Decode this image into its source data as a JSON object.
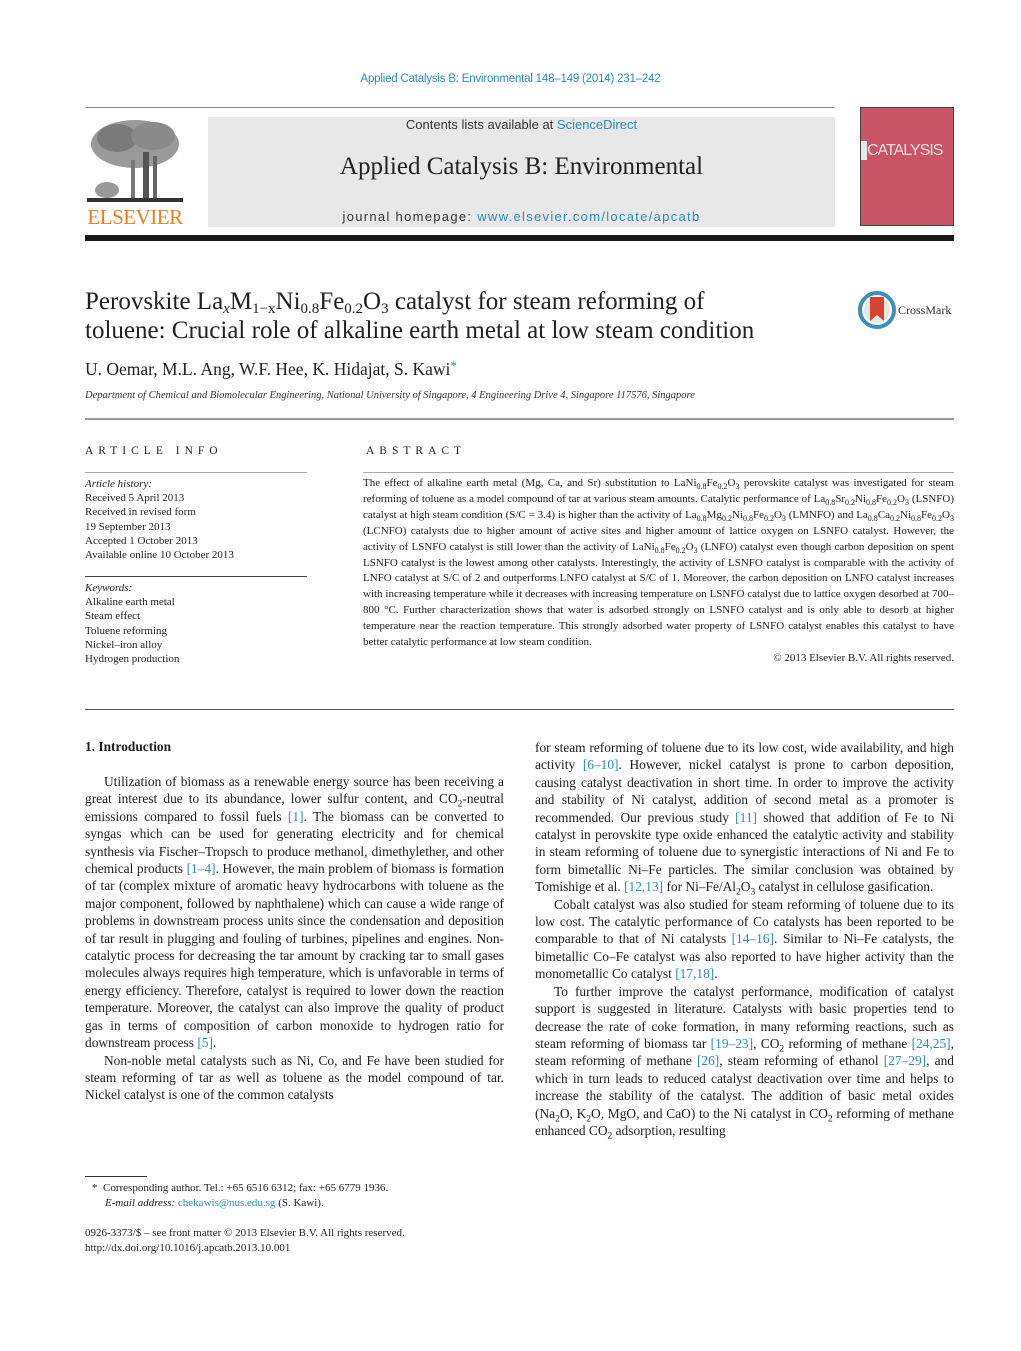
{
  "header": {
    "citation": "Applied Catalysis B: Environmental 148–149 (2014) 231–242",
    "publisher_logo_text": "ELSEVIER",
    "contents_prefix": "Contents lists available at ",
    "contents_link": "ScienceDirect",
    "journal_title": "Applied Catalysis B: Environmental",
    "homepage_prefix": "journal homepage: ",
    "homepage_link": "www.elsevier.com/locate/apcatb",
    "cover_word": "CATALYSIS",
    "cover_color": "#c95466",
    "link_color": "#2a8cb8",
    "logo_color": "#f07c1a"
  },
  "article": {
    "title_part1": "Perovskite La",
    "title_sub1": "x",
    "title_part2": "M",
    "title_sub2": "1−x",
    "title_part3": "Ni",
    "title_sub3": "0.8",
    "title_part4": "Fe",
    "title_sub4": "0.2",
    "title_part5": "O",
    "title_sub5": "3",
    "title_part6": " catalyst for steam reforming of",
    "title_line2": "toluene: Crucial role of alkaline earth metal at low steam condition",
    "crossmark_label": "CrossMark",
    "authors": "U. Oemar, M.L. Ang, W.F. Hee, K. Hidajat, S. Kawi",
    "corresponding_mark": "*",
    "affiliation": "Department of Chemical and Biomolecular Engineering, National University of Singapore, 4 Engineering Drive 4, Singapore 117576, Singapore"
  },
  "article_info": {
    "heading": "ARTICLE INFO",
    "history_label": "Article history:",
    "history": [
      "Received 5 April 2013",
      "Received in revised form",
      "19 September 2013",
      "Accepted 1 October 2013",
      "Available online 10 October 2013"
    ],
    "keywords_label": "Keywords:",
    "keywords": [
      "Alkaline earth metal",
      "Steam effect",
      "Toluene reforming",
      "Nickel–iron alloy",
      "Hydrogen production"
    ]
  },
  "abstract": {
    "heading": "ABSTRACT",
    "s1": "The effect of alkaline earth metal (Mg, Ca, and Sr) substitution to LaNi",
    "s2": "Fe",
    "s3": "O",
    "s4": " perovskite catalyst was investigated for steam reforming of toluene as a model compound of tar at various steam amounts. Catalytic performance of La",
    "s5": "Sr",
    "s6": "Ni",
    "s7": "Fe",
    "s8": "O",
    "s9": " (LSNFO) catalyst at high steam condition (S/C = 3.4) is higher than the activity of La",
    "s10": "Mg",
    "s11": "Ni",
    "s12": "Fe",
    "s13": "O",
    "s14": " (LMNFO) and La",
    "s15": "Ca",
    "s16": "Ni",
    "s17": "Fe",
    "s18": "O",
    "s19": " (LCNFO) catalysts due to higher amount of active sites and higher amount of lattice oxygen on LSNFO catalyst. However, the activity of LSNFO catalyst is still lower than the activity of LaNi",
    "s20": "Fe",
    "s21": "O",
    "s22": " (LNFO) catalyst even though carbon deposition on spent LSNFO catalyst is the lowest among other catalysts. Interestingly, the activity of LSNFO catalyst is comparable with the activity of LNFO catalyst at S/C of 2 and outperforms LNFO catalyst at S/C of 1. Moreover, the carbon deposition on LNFO catalyst increases with increasing temperature while it decreases with increasing temperature on LSNFO catalyst due to lattice oxygen desorbed at 700–800 °C. Further characterization shows that water is adsorbed strongly on LSNFO catalyst and is only able to desorb at higher temperature near the reaction temperature. This strongly adsorbed water property of LSNFO catalyst enables this catalyst to have better catalytic performance at low steam condition.",
    "sub_08": "0.8",
    "sub_02": "0.2",
    "sub_3": "3",
    "copyright": "© 2013 Elsevier B.V. All rights reserved."
  },
  "body": {
    "section_heading": "1.  Introduction",
    "p1_a": "Utilization of biomass as a renewable energy source has been receiving a great interest due to its abundance, lower sulfur content, and CO",
    "p1_b": "-neutral emissions compared to fossil fuels ",
    "p1_ref1": "[1]",
    "p1_c": ". The biomass can be converted to syngas which can be used for generating electricity and for chemical synthesis via Fischer–Tropsch to produce methanol, dimethylether, and other chemical products ",
    "p1_ref2": "[1–4]",
    "p1_d": ". However, the main problem of biomass is formation of tar (complex mixture of aromatic heavy hydrocarbons with toluene as the major component, followed by naphthalene) which can cause a wide range of problems in downstream process units since the condensation and deposition of tar result in plugging and fouling of turbines, pipelines and engines. Non-catalytic process for decreasing the tar amount by cracking tar to small gases molecules always requires high temperature, which is unfavorable in terms of energy efficiency. Therefore, catalyst is required to lower down the reaction temperature. Moreover, the catalyst can also improve the quality of product gas in terms of composition of carbon monoxide to hydrogen ratio for downstream process ",
    "p1_ref3": "[5]",
    "p1_e": ".",
    "p2_a": "Non-noble metal catalysts such as Ni, Co, and Fe have been studied for steam reforming of tar as well as toluene as the model compound of tar. Nickel catalyst is one of the common catalysts",
    "r1_a": "for steam reforming of toluene due to its low cost, wide availability, and high activity ",
    "r1_ref1": "[6–10]",
    "r1_b": ". However, nickel catalyst is prone to carbon deposition, causing catalyst deactivation in short time. In order to improve the activity and stability of Ni catalyst, addition of second metal as a promoter is recommended. Our previous study ",
    "r1_ref2": "[11]",
    "r1_c": " showed that addition of Fe to Ni catalyst in perovskite type oxide enhanced the catalytic activity and stability in steam reforming of toluene due to synergistic interactions of Ni and Fe to form bimetallic Ni–Fe particles. The similar conclusion was obtained by Tomishige et al. ",
    "r1_ref3": "[12,13]",
    "r1_d": " for Ni–Fe/Al",
    "r1_e": "O",
    "r1_f": " catalyst in cellulose gasification.",
    "r2_a": "Cobalt catalyst was also studied for steam reforming of toluene due to its low cost. The catalytic performance of Co catalysts has been reported to be comparable to that of Ni catalysts ",
    "r2_ref1": "[14–16]",
    "r2_b": ". Similar to Ni–Fe catalysts, the bimetallic Co–Fe catalyst was also reported to have higher activity than the monometallic Co catalyst ",
    "r2_ref2": "[17,18]",
    "r2_c": ".",
    "r3_a": "To further improve the catalyst performance, modification of catalyst support is suggested in literature. Catalysts with basic properties tend to decrease the rate of coke formation, in many reforming reactions, such as steam reforming of biomass tar ",
    "r3_ref1": "[19–23]",
    "r3_b": ", CO",
    "r3_c": " reforming of methane ",
    "r3_ref2": "[24,25]",
    "r3_d": ", steam reforming of methane ",
    "r3_ref3": "[26]",
    "r3_e": ", steam reforming of ethanol ",
    "r3_ref4": "[27–29]",
    "r3_f": ", and which in turn leads to reduced catalyst deactivation over time and helps to increase the stability of the catalyst. The addition of basic metal oxides (Na",
    "r3_g": "O, K",
    "r3_h": "O, MgO, and CaO) to the Ni catalyst in CO",
    "r3_i": " reforming of methane enhanced CO",
    "r3_j": " adsorption, resulting",
    "sub2": "2",
    "sub3": "3"
  },
  "footnotes": {
    "star": "*",
    "corresponding": "Corresponding author. Tel.: +65 6516 6312; fax: +65 6779 1936.",
    "email_label": "E-mail address: ",
    "email": "chekawis@nus.edu.sg",
    "email_suffix": " (S. Kawi).",
    "front_matter": "0926-3373/$ – see front matter © 2013 Elsevier B.V. All rights reserved.",
    "doi": "http://dx.doi.org/10.1016/j.apcatb.2013.10.001"
  }
}
